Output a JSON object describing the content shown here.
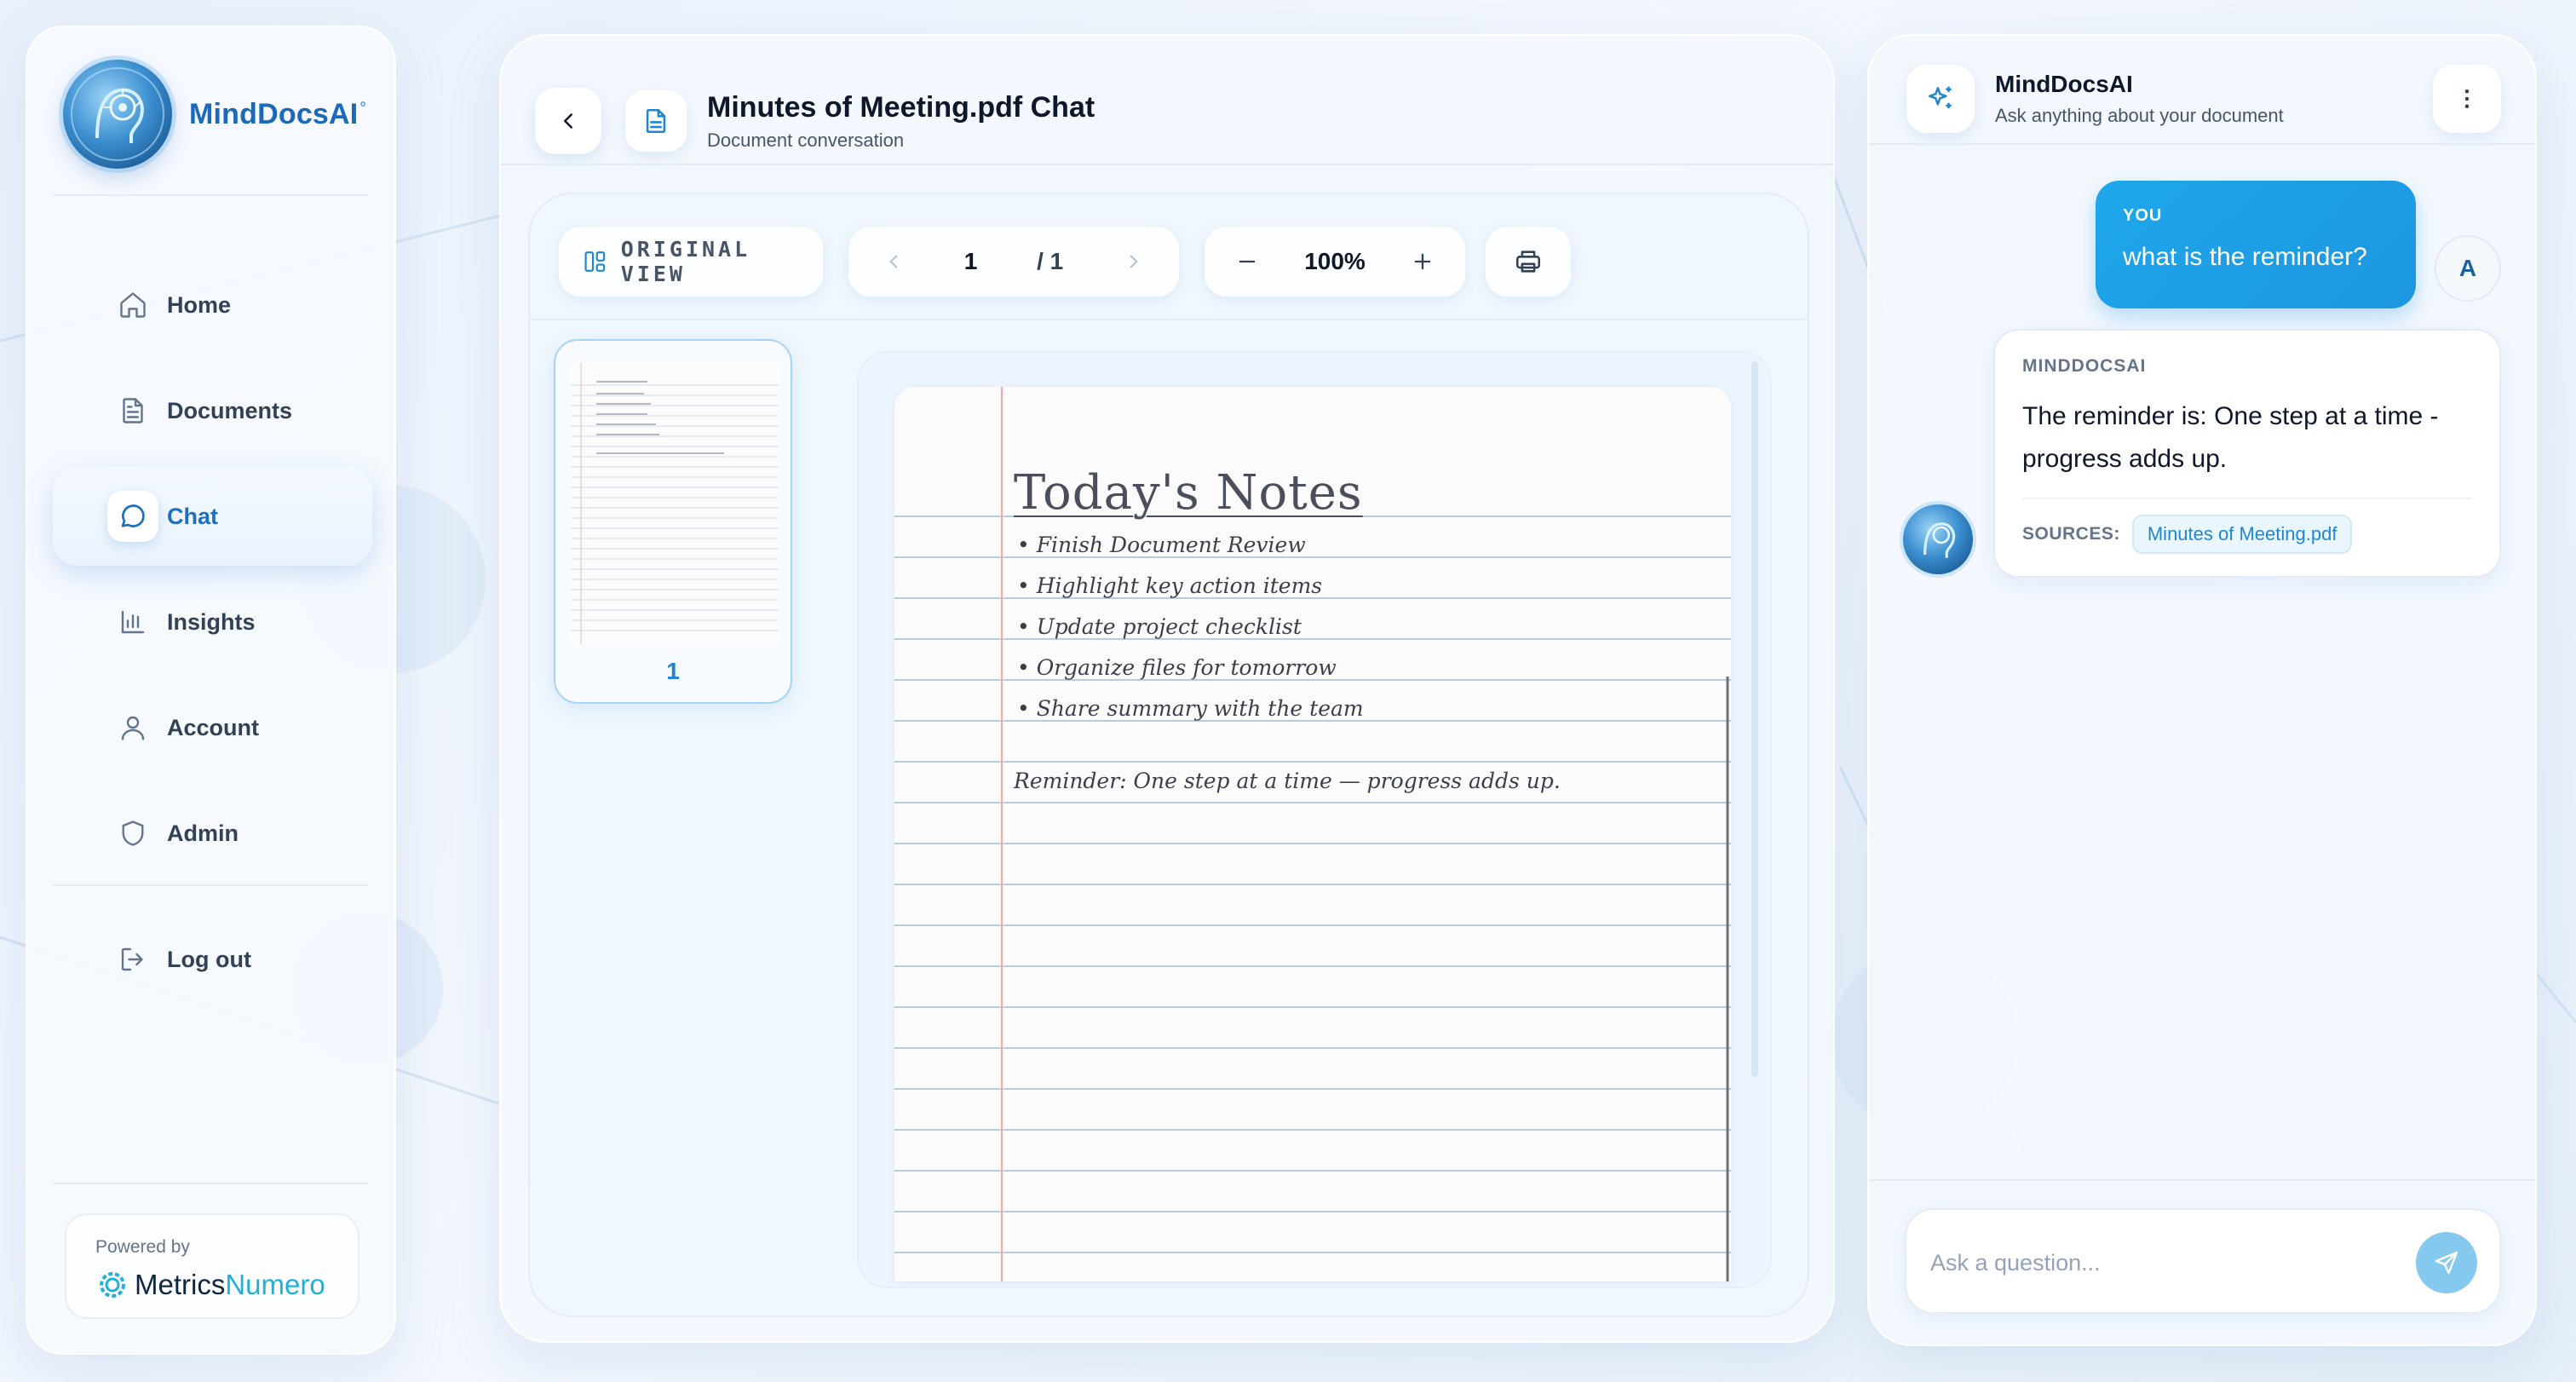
{
  "brand": {
    "name": "MindDocsAI",
    "mark": "°"
  },
  "sidebar": {
    "items": [
      {
        "label": "Home",
        "icon": "home-icon"
      },
      {
        "label": "Documents",
        "icon": "document-icon"
      },
      {
        "label": "Chat",
        "icon": "chat-bubble-icon",
        "active": true
      },
      {
        "label": "Insights",
        "icon": "bar-chart-icon"
      },
      {
        "label": "Account",
        "icon": "user-icon"
      },
      {
        "label": "Admin",
        "icon": "shield-icon"
      }
    ],
    "logout": "Log out",
    "powered_by": "Powered by",
    "vendor_part1": "Metrics",
    "vendor_part2": "Numero"
  },
  "header": {
    "title": "Minutes of Meeting.pdf Chat",
    "subtitle": "Document conversation"
  },
  "toolbar": {
    "view_label": "ORIGINAL VIEW",
    "current_page": "1",
    "total_pages": "/ 1",
    "zoom": "100%"
  },
  "thumbnail": {
    "page_number": "1"
  },
  "document": {
    "heading": "Today's Notes",
    "bullets": [
      "Finish Document Review",
      "Highlight key action items",
      "Update project checklist",
      "Organize files for tomorrow",
      "Share summary with the team"
    ],
    "reminder": "Reminder: One step at a time — progress adds up."
  },
  "chat": {
    "title": "MindDocsAI",
    "subtitle": "Ask anything about your document",
    "user_label": "YOU",
    "user_message": "what is the reminder?",
    "user_avatar": "A",
    "ai_label": "MINDDOCSAI",
    "ai_message": "The reminder is: One step at a time - progress adds up.",
    "sources_label": "SOURCES:",
    "source_file": "Minutes of Meeting.pdf",
    "input_placeholder": "Ask a question..."
  },
  "colors": {
    "accent": "#1fa7ea",
    "brand": "#1b69b8",
    "active_nav": "#1f6fbf"
  }
}
